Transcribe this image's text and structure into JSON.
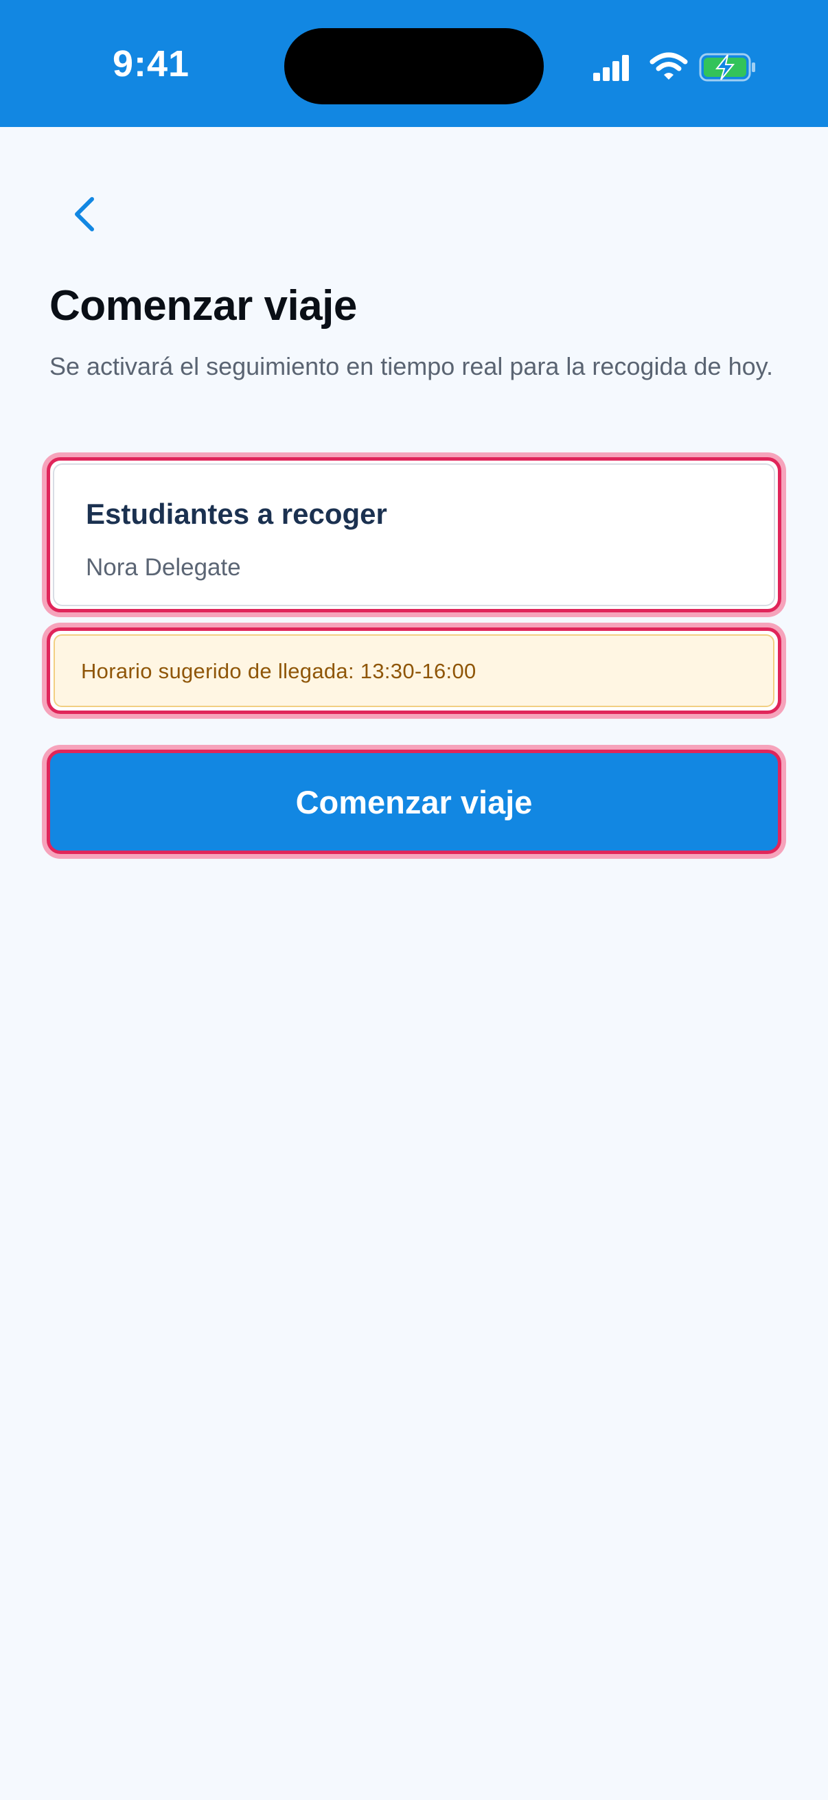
{
  "status_bar": {
    "time": "9:41",
    "icons": [
      "signal-icon",
      "wifi-icon",
      "battery-charging-icon"
    ],
    "background_color": "#1287e2"
  },
  "navigation": {
    "back_icon": "chevron-left-icon"
  },
  "page": {
    "title": "Comenzar viaje",
    "subtitle": "Se activará el seguimiento en tiempo real para la recogida de hoy."
  },
  "students_card": {
    "title": "Estudiantes a recoger",
    "student_name": "Nora Delegate"
  },
  "notice": {
    "text": "Horario sugerido de llegada: 13:30-16:00",
    "background_color": "#fff6e3",
    "text_color": "#8f5608"
  },
  "primary_action": {
    "label": "Comenzar viaje",
    "color": "#1287e2"
  },
  "colors": {
    "accent": "#1287e2",
    "page_background": "#f5f9fe",
    "highlight_border": "#e0255a"
  }
}
